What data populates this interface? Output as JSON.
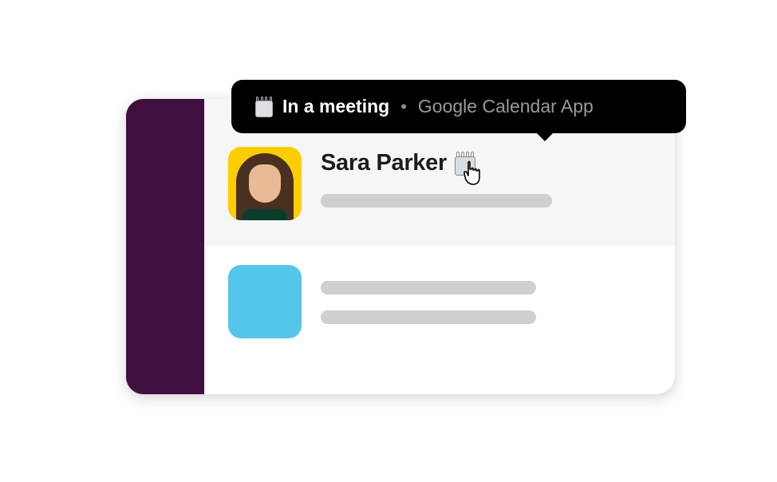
{
  "tooltip": {
    "status_text": "In a meeting",
    "separator": "•",
    "source_text": "Google Calendar App",
    "icon_name": "calendar-notepad-icon"
  },
  "messages": [
    {
      "author_name": "Sara Parker",
      "avatar_kind": "photo",
      "status_icon_name": "calendar-notepad-icon"
    },
    {
      "author_name": "",
      "avatar_kind": "placeholder-blue"
    }
  ],
  "colors": {
    "sidebar": "#3f0f3f",
    "avatar_blue": "#54c6ea",
    "avatar_yellow": "#ffcd00",
    "tooltip_bg": "#000000"
  }
}
